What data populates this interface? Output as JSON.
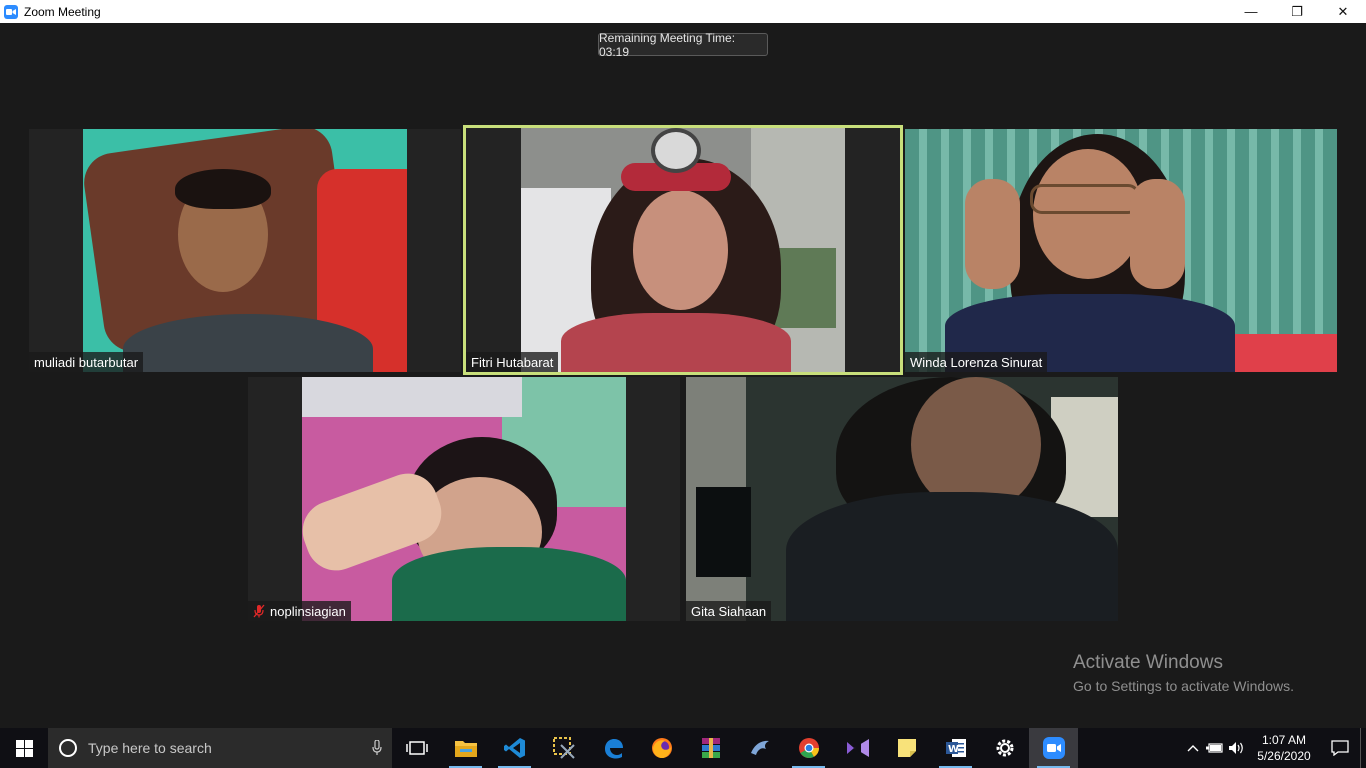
{
  "window": {
    "title": "Zoom Meeting",
    "minimize": "—",
    "maximize": "❐",
    "close": "✕"
  },
  "timer": {
    "text": "Remaining Meeting Time: 03:19"
  },
  "participants": [
    {
      "name": "muliadi butarbutar",
      "muted": false,
      "active": false
    },
    {
      "name": "Fitri Hutabarat",
      "muted": false,
      "active": true
    },
    {
      "name": "Winda Lorenza Sinurat",
      "muted": false,
      "active": false
    },
    {
      "name": "noplinsiagian",
      "muted": true,
      "active": false
    },
    {
      "name": "Gita Siahaan",
      "muted": false,
      "active": false
    }
  ],
  "watermark": {
    "line1": "Activate Windows",
    "line2": "Go to Settings to activate Windows."
  },
  "taskbar": {
    "search_placeholder": "Type here to search",
    "apps": [
      "task-view",
      "file-explorer",
      "vscode",
      "snipping-tool",
      "edge",
      "firefox",
      "winrar",
      "dolphin",
      "chrome",
      "visual-studio",
      "sticky-notes",
      "word",
      "settings",
      "zoom"
    ],
    "time": "1:07 AM",
    "date": "5/26/2020"
  },
  "colors": {
    "accent": "#2d8cff",
    "active_border": "#c8df7b",
    "taskbar": "#0f0f14"
  }
}
